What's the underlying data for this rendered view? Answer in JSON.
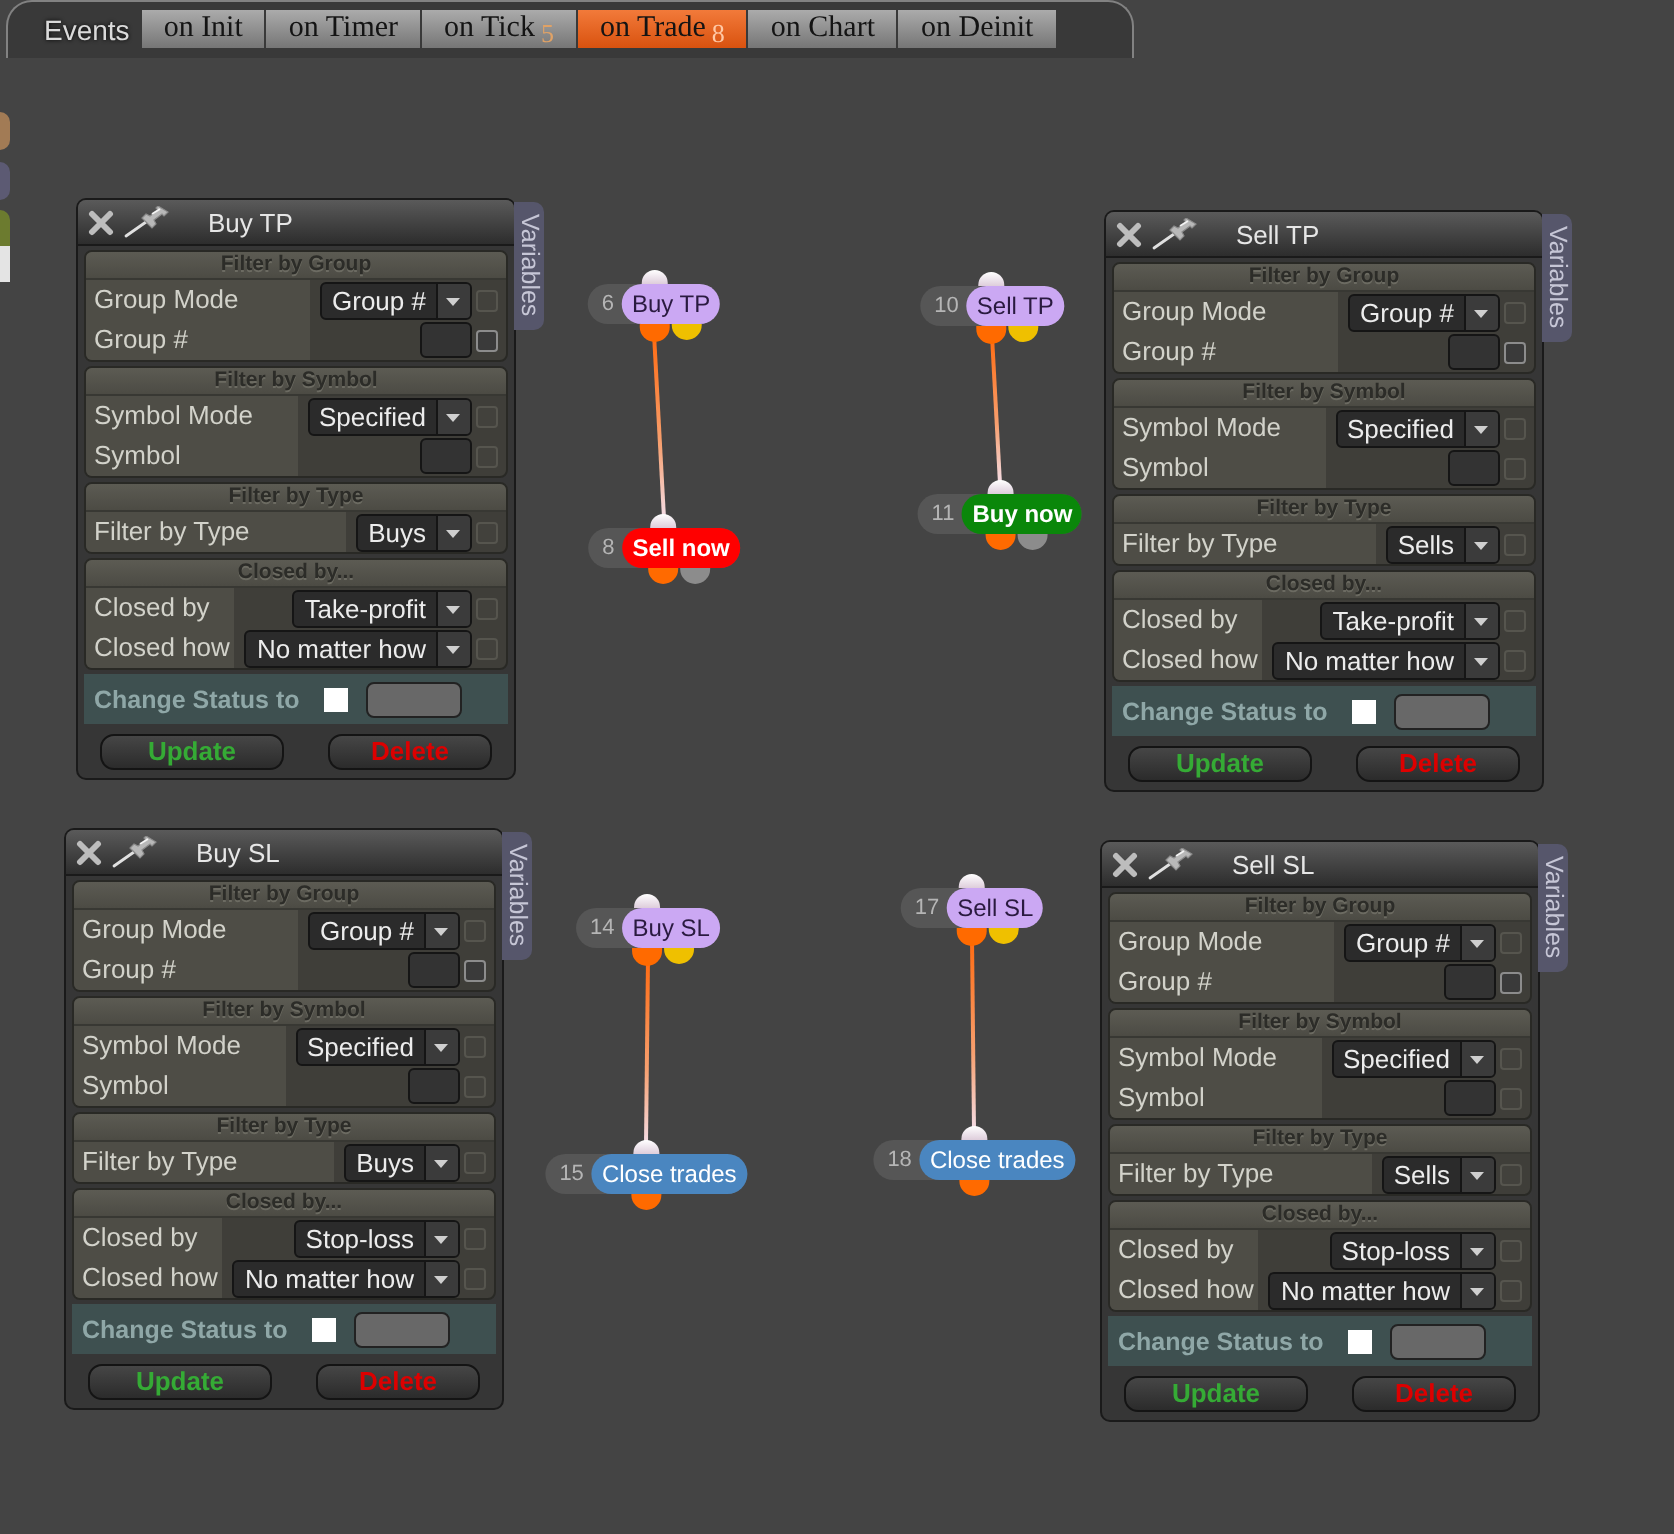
{
  "event_bar": {
    "label": "Events",
    "tabs": [
      {
        "label": "on Init",
        "selected": false
      },
      {
        "label": "on Timer",
        "selected": false
      },
      {
        "label": "on Tick",
        "badge": "5",
        "selected": false
      },
      {
        "label": "on Trade",
        "badge": "8",
        "selected": true
      },
      {
        "label": "on Chart",
        "selected": false
      },
      {
        "label": "on Deinit",
        "selected": false
      }
    ]
  },
  "panels": [
    {
      "title": "Buy TP",
      "side_tab": "Variables",
      "sections": [
        {
          "heading": "Filter by Group",
          "rows": [
            {
              "label": "Group Mode",
              "kind": "select",
              "value": "Group #",
              "toggle_disabled": true
            },
            {
              "label": "Group #",
              "kind": "input",
              "toggle_disabled": false
            }
          ]
        },
        {
          "heading": "Filter by Symbol",
          "rows": [
            {
              "label": "Symbol Mode",
              "kind": "select",
              "value": "Specified",
              "toggle_disabled": true
            },
            {
              "label": "Symbol",
              "kind": "input",
              "toggle_disabled": true
            }
          ]
        },
        {
          "heading": "Filter by Type",
          "rows": [
            {
              "label": "Filter by Type",
              "kind": "select",
              "value": "Buys",
              "toggle_disabled": true
            }
          ]
        },
        {
          "heading": "Closed by...",
          "rows": [
            {
              "label": "Closed by",
              "kind": "select",
              "value": "Take-profit",
              "toggle_disabled": true
            },
            {
              "label": "Closed how",
              "kind": "select",
              "value": "No matter how",
              "toggle_disabled": true
            }
          ]
        }
      ],
      "status": {
        "label": "Change Status to",
        "checked": false
      },
      "buttons": [
        {
          "label": "Update",
          "kind": "update"
        },
        {
          "label": "Delete",
          "kind": "delete"
        }
      ]
    },
    {
      "title": "Sell TP",
      "side_tab": "Variables",
      "sections": [
        {
          "heading": "Filter by Group",
          "rows": [
            {
              "label": "Group Mode",
              "kind": "select",
              "value": "Group #",
              "toggle_disabled": true
            },
            {
              "label": "Group #",
              "kind": "input",
              "toggle_disabled": false
            }
          ]
        },
        {
          "heading": "Filter by Symbol",
          "rows": [
            {
              "label": "Symbol Mode",
              "kind": "select",
              "value": "Specified",
              "toggle_disabled": true
            },
            {
              "label": "Symbol",
              "kind": "input",
              "toggle_disabled": true
            }
          ]
        },
        {
          "heading": "Filter by Type",
          "rows": [
            {
              "label": "Filter by Type",
              "kind": "select",
              "value": "Sells",
              "toggle_disabled": true
            }
          ]
        },
        {
          "heading": "Closed by...",
          "rows": [
            {
              "label": "Closed by",
              "kind": "select",
              "value": "Take-profit",
              "toggle_disabled": true
            },
            {
              "label": "Closed how",
              "kind": "select",
              "value": "No matter how",
              "toggle_disabled": true
            }
          ]
        }
      ],
      "status": {
        "label": "Change Status to",
        "checked": false
      },
      "buttons": [
        {
          "label": "Update",
          "kind": "update"
        },
        {
          "label": "Delete",
          "kind": "delete"
        }
      ]
    },
    {
      "title": "Buy SL",
      "side_tab": "Variables",
      "sections": [
        {
          "heading": "Filter by Group",
          "rows": [
            {
              "label": "Group Mode",
              "kind": "select",
              "value": "Group #",
              "toggle_disabled": true
            },
            {
              "label": "Group #",
              "kind": "input",
              "toggle_disabled": false
            }
          ]
        },
        {
          "heading": "Filter by Symbol",
          "rows": [
            {
              "label": "Symbol Mode",
              "kind": "select",
              "value": "Specified",
              "toggle_disabled": true
            },
            {
              "label": "Symbol",
              "kind": "input",
              "toggle_disabled": true
            }
          ]
        },
        {
          "heading": "Filter by Type",
          "rows": [
            {
              "label": "Filter by Type",
              "kind": "select",
              "value": "Buys",
              "toggle_disabled": true
            }
          ]
        },
        {
          "heading": "Closed by...",
          "rows": [
            {
              "label": "Closed by",
              "kind": "select",
              "value": "Stop-loss",
              "toggle_disabled": true
            },
            {
              "label": "Closed how",
              "kind": "select",
              "value": "No matter how",
              "toggle_disabled": true
            }
          ]
        }
      ],
      "status": {
        "label": "Change Status to",
        "checked": false
      },
      "buttons": [
        {
          "label": "Update",
          "kind": "update"
        },
        {
          "label": "Delete",
          "kind": "delete"
        }
      ]
    },
    {
      "title": "Sell SL",
      "side_tab": "Variables",
      "sections": [
        {
          "heading": "Filter by Group",
          "rows": [
            {
              "label": "Group Mode",
              "kind": "select",
              "value": "Group #",
              "toggle_disabled": true
            },
            {
              "label": "Group #",
              "kind": "input",
              "toggle_disabled": false
            }
          ]
        },
        {
          "heading": "Filter by Symbol",
          "rows": [
            {
              "label": "Symbol Mode",
              "kind": "select",
              "value": "Specified",
              "toggle_disabled": true
            },
            {
              "label": "Symbol",
              "kind": "input",
              "toggle_disabled": true
            }
          ]
        },
        {
          "heading": "Filter by Type",
          "rows": [
            {
              "label": "Filter by Type",
              "kind": "select",
              "value": "Sells",
              "toggle_disabled": true
            }
          ]
        },
        {
          "heading": "Closed by...",
          "rows": [
            {
              "label": "Closed by",
              "kind": "select",
              "value": "Stop-loss",
              "toggle_disabled": true
            },
            {
              "label": "Closed how",
              "kind": "select",
              "value": "No matter how",
              "toggle_disabled": true
            }
          ]
        }
      ],
      "status": {
        "label": "Change Status to",
        "checked": false
      },
      "buttons": [
        {
          "label": "Update",
          "kind": "update"
        },
        {
          "label": "Delete",
          "kind": "delete"
        }
      ]
    }
  ],
  "nodes": [
    {
      "number": "6",
      "label": "Buy TP",
      "kind": "filter",
      "color": "#cba8f3",
      "outputs": [
        {
          "color": "#ff6a00",
          "linked": true
        },
        {
          "color": "#efc000",
          "linked": false
        }
      ]
    },
    {
      "number": "8",
      "label": "Sell now",
      "kind": "order",
      "color": "#ff0000",
      "outputs": [
        {
          "color": "#ff6a00",
          "linked": false
        },
        {
          "color": "#8c8c8c",
          "linked": false
        }
      ]
    },
    {
      "number": "10",
      "label": "Sell TP",
      "kind": "filter",
      "color": "#cba8f3",
      "outputs": [
        {
          "color": "#ff6a00",
          "linked": true
        },
        {
          "color": "#efc000",
          "linked": false
        }
      ]
    },
    {
      "number": "11",
      "label": "Buy now",
      "kind": "order",
      "color": "#0a870a",
      "outputs": [
        {
          "color": "#ff6a00",
          "linked": false
        },
        {
          "color": "#8c8c8c",
          "linked": false
        }
      ]
    },
    {
      "number": "14",
      "label": "Buy SL",
      "kind": "filter",
      "color": "#cba8f3",
      "outputs": [
        {
          "color": "#ff6a00",
          "linked": true
        },
        {
          "color": "#efc000",
          "linked": false
        }
      ]
    },
    {
      "number": "15",
      "label": "Close trades",
      "kind": "close",
      "color": "#4a86c0",
      "outputs": [
        {
          "color": "#ff6a00",
          "linked": false
        }
      ]
    },
    {
      "number": "17",
      "label": "Sell SL",
      "kind": "filter",
      "color": "#cba8f3",
      "outputs": [
        {
          "color": "#ff6a00",
          "linked": true
        },
        {
          "color": "#efc000",
          "linked": false
        }
      ]
    },
    {
      "number": "18",
      "label": "Close trades",
      "kind": "close",
      "color": "#4a86c0",
      "outputs": [
        {
          "color": "#ff6a00",
          "linked": false
        }
      ]
    }
  ]
}
